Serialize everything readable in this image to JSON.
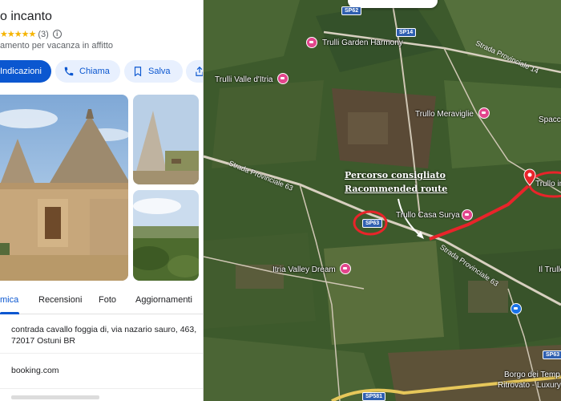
{
  "panel": {
    "title": "o incanto",
    "rating": {
      "stars": "★★★★★",
      "count": "(3)"
    },
    "category": "amento per vacanza in affitto",
    "actions": [
      {
        "label": "Indicazioni",
        "icon": "directions-icon"
      },
      {
        "label": "Chiama",
        "icon": "phone-icon"
      },
      {
        "label": "Salva",
        "icon": "bookmark-icon"
      },
      {
        "label": "",
        "icon": "share-icon"
      }
    ],
    "tabs": [
      {
        "label": "mica",
        "active": true
      },
      {
        "label": "Recensioni",
        "active": false
      },
      {
        "label": "Foto",
        "active": false
      },
      {
        "label": "Aggiornamenti",
        "active": false
      }
    ],
    "address": "contrada cavallo foggia di, via nazario sauro, 463, 72017 Ostuni BR",
    "website": "booking.com"
  },
  "map": {
    "places": [
      {
        "name": "Trulli Garden Harmony"
      },
      {
        "name": "Trulli Valle d'Itria"
      },
      {
        "name": "Trullo Meraviglie"
      },
      {
        "name": "Spacc"
      },
      {
        "name": "Trullo in"
      },
      {
        "name": "Trullo Casa Surya"
      },
      {
        "name": "Itria Valley Dream"
      },
      {
        "name": "Il Trullo"
      },
      {
        "name": "Borgo dei Temp"
      },
      {
        "name": "Ritrovato - Luxury"
      }
    ],
    "roads": [
      {
        "name": "Strada Provinciale 14"
      },
      {
        "name": "Strada Provinciale 63"
      },
      {
        "name": "Strada Provinciale 63"
      }
    ],
    "shields": [
      "SP62",
      "SP14",
      "SP63",
      "SP63",
      "SP581"
    ],
    "annotation": {
      "line1": "Percorso consigliato",
      "line2": "Racommended route"
    },
    "colors": {
      "route": "#e8242a",
      "pin": "#e2458c",
      "highlight": "#e8242a"
    }
  }
}
